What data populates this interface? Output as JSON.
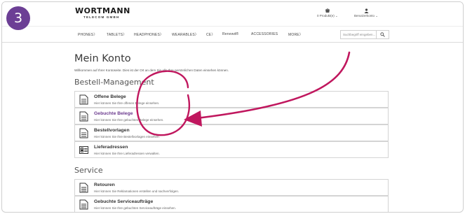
{
  "step_badge": "3",
  "header": {
    "brand": "WORTMANN",
    "brand_sub": "TELECOM GMBH",
    "cart_label": "0 Produkt(e) ⌄",
    "account_label": "Benutzerkonto ⌄"
  },
  "nav": {
    "items": [
      "PHONES〉",
      "TABLETS〉",
      "HEADPHONES〉",
      "WEARABLES〉",
      "CE〉",
      "Renewd®",
      "ACCESSORIES",
      "MORE〉"
    ],
    "search_placeholder": "Suchbegriff eingeben..."
  },
  "page": {
    "title": "Mein Konto",
    "intro": "Willkommen auf Ihrer Kontoseite. Dies ist der Ort an dem Sie alle Ihre persönlichen Daten einsehen können."
  },
  "sections": [
    {
      "title": "Bestell-Management",
      "cards": [
        {
          "name": "Offene Belege",
          "desc": "Hier können Sie Ihre offenen Belege einsehen."
        },
        {
          "name": "Gebuchte Belege",
          "desc": "Hier können Sie Ihre gebuchten Belege einsehen."
        },
        {
          "name": "Bestellvorlagen",
          "desc": "Hier können Sie Ihre Bestellvorlagen einsehen."
        },
        {
          "name": "Lieferadressen",
          "desc": "Hier können Sie Ihre Lieferadressen verwalten."
        }
      ]
    },
    {
      "title": "Service",
      "cards": [
        {
          "name": "Retouren",
          "desc": "Hier können Sie Reklamationen erstellen und nachverfolgen."
        },
        {
          "name": "Gebuchte Serviceaufträge",
          "desc": "Hier können Sie Ihre gebuchten Serviceaufträge einsehen."
        }
      ]
    }
  ],
  "colors": {
    "badge": "#6c3f95",
    "annotation": "#c0175e",
    "highlight_link": "#6b3a8e"
  }
}
